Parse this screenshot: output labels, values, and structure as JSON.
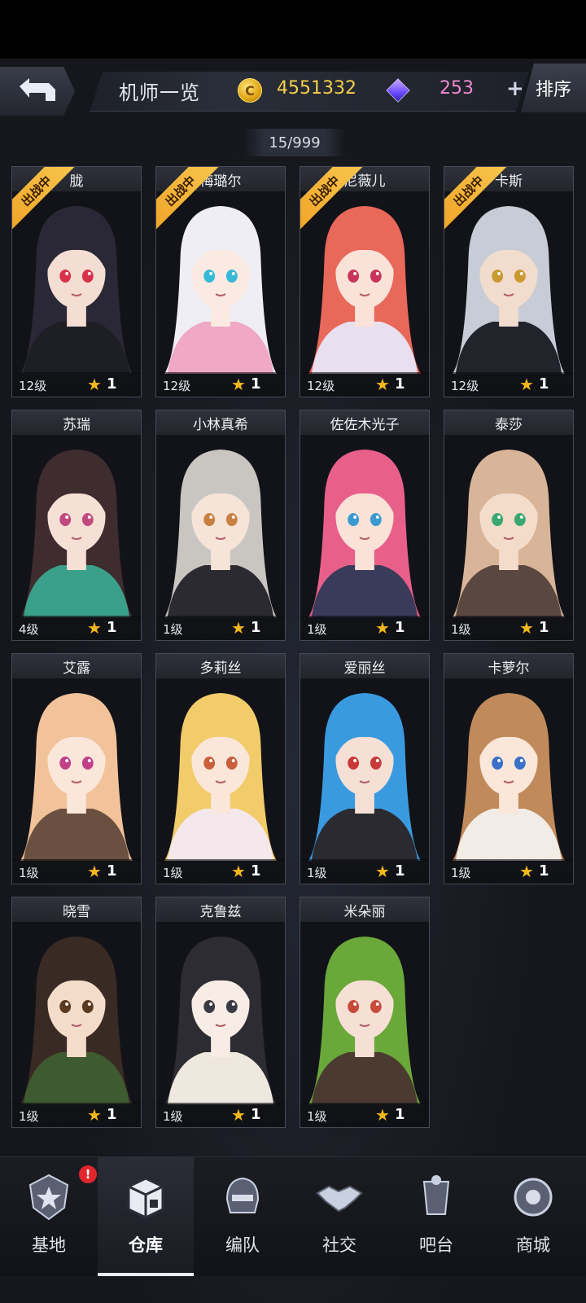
{
  "header": {
    "title": "机师一览",
    "coins": "4551332",
    "gems": "253",
    "plus": "+",
    "sort_label": "排序"
  },
  "count": "15/999",
  "colors": {
    "coin": "#f5d04a",
    "gem": "#f08ad0",
    "star": "#f2b81c",
    "deployed_ribbon": "#f0a52a",
    "alert": "#e0262c"
  },
  "deployed_label": "出战中",
  "cards": [
    {
      "name": "胧",
      "level": "12级",
      "stars": "1",
      "deployed": true,
      "hair": "#2a2836",
      "skin": "#f4ddd2",
      "outfit": "#1e1f25",
      "eye": "#d8324a"
    },
    {
      "name": "梅璐尔",
      "level": "12级",
      "stars": "1",
      "deployed": true,
      "hair": "#eeeef4",
      "skin": "#fbeae2",
      "outfit": "#f0a8c4",
      "eye": "#36b8d8"
    },
    {
      "name": "尼薇儿",
      "level": "12级",
      "stars": "1",
      "deployed": true,
      "hair": "#e8685a",
      "skin": "#fbe2d8",
      "outfit": "#e8e0f0",
      "eye": "#c8345a"
    },
    {
      "name": "卡斯",
      "level": "12级",
      "stars": "1",
      "deployed": true,
      "hair": "#c8ccd6",
      "skin": "#f2dccd",
      "outfit": "#22242c",
      "eye": "#c89a30"
    },
    {
      "name": "苏瑞",
      "level": "4级",
      "stars": "1",
      "deployed": false,
      "hair": "#3e2c2e",
      "skin": "#f6e0d6",
      "outfit": "#3aa08a",
      "eye": "#c04a80"
    },
    {
      "name": "小林真希",
      "level": "1级",
      "stars": "1",
      "deployed": false,
      "hair": "#c9c6c2",
      "skin": "#f6e4d8",
      "outfit": "#2a2a30",
      "eye": "#c88040"
    },
    {
      "name": "佐佐木光子",
      "level": "1级",
      "stars": "1",
      "deployed": false,
      "hair": "#e8608a",
      "skin": "#fbe2d8",
      "outfit": "#3a3a5a",
      "eye": "#3a9ad0"
    },
    {
      "name": "泰莎",
      "level": "1级",
      "stars": "1",
      "deployed": false,
      "hair": "#d8b498",
      "skin": "#f4dccb",
      "outfit": "#5a4840",
      "eye": "#3aa870"
    },
    {
      "name": "艾露",
      "level": "1级",
      "stars": "1",
      "deployed": false,
      "hair": "#f2c29a",
      "skin": "#fbe6da",
      "outfit": "#6a5040",
      "eye": "#c0408a"
    },
    {
      "name": "多莉丝",
      "level": "1级",
      "stars": "1",
      "deployed": false,
      "hair": "#f2cc6a",
      "skin": "#fbe6da",
      "outfit": "#f4e8ec",
      "eye": "#c8603a"
    },
    {
      "name": "爱丽丝",
      "level": "1级",
      "stars": "1",
      "deployed": false,
      "hair": "#3a9ae0",
      "skin": "#f6e0d6",
      "outfit": "#2a2a30",
      "eye": "#c83a3a"
    },
    {
      "name": "卡萝尔",
      "level": "1级",
      "stars": "1",
      "deployed": false,
      "hair": "#c08a5a",
      "skin": "#fbe6da",
      "outfit": "#f2ece6",
      "eye": "#3a70c8"
    },
    {
      "name": "晓雪",
      "level": "1级",
      "stars": "1",
      "deployed": false,
      "hair": "#3a2a24",
      "skin": "#f4dccb",
      "outfit": "#3e5a30",
      "eye": "#5a3a20"
    },
    {
      "name": "克鲁兹",
      "level": "1级",
      "stars": "1",
      "deployed": false,
      "hair": "#2c2c32",
      "skin": "#f8ece6",
      "outfit": "#eee8de",
      "eye": "#3a3a44"
    },
    {
      "name": "米朵丽",
      "level": "1级",
      "stars": "1",
      "deployed": false,
      "hair": "#6aa83a",
      "skin": "#f6e0d6",
      "outfit": "#4a3a30",
      "eye": "#c84a3a"
    }
  ],
  "nav": [
    {
      "label": "基地",
      "icon": "base-emblem-icon",
      "alert": "!"
    },
    {
      "label": "仓库",
      "icon": "warehouse-crate-icon",
      "active": true
    },
    {
      "label": "编队",
      "icon": "mech-helmet-icon"
    },
    {
      "label": "社交",
      "icon": "handshake-icon"
    },
    {
      "label": "吧台",
      "icon": "bar-cup-icon"
    },
    {
      "label": "商城",
      "icon": "shop-orb-icon"
    }
  ]
}
